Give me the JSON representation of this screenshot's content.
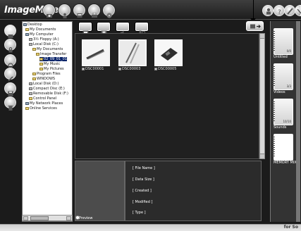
{
  "app": {
    "title": "ImageMixer"
  },
  "top_buttons": [
    {
      "icon": "camera-icon"
    },
    {
      "icon": "person-icon"
    },
    {
      "icon": "album-icon"
    },
    {
      "icon": "print-icon"
    },
    {
      "icon": "cd-icon"
    }
  ],
  "right_buttons": [
    {
      "icon": "person-icon"
    },
    {
      "icon": "help-icon"
    },
    {
      "icon": "pen-icon"
    },
    {
      "icon": "close-icon"
    }
  ],
  "left_tools": [
    {
      "icon": "folder-icon"
    },
    {
      "icon": "lock-icon"
    },
    {
      "icon": "rotate-icon"
    },
    {
      "icon": "wrench-icon"
    },
    {
      "icon": "disk-icon"
    },
    {
      "icon": "trash-icon"
    }
  ],
  "tree": [
    {
      "label": "Desktop",
      "type": "pc"
    },
    {
      "label": "My Documents",
      "type": "folder"
    },
    {
      "label": "My Computer",
      "type": "pc"
    },
    {
      "label": "3½ Floppy (A:)",
      "type": "drive"
    },
    {
      "label": "Local Disk (C:)",
      "type": "drive"
    },
    {
      "label": "My Documents",
      "type": "folder"
    },
    {
      "label": "Image Transfer",
      "type": "folder"
    },
    {
      "label": "02_09_01_01",
      "type": "folder",
      "selected": true
    },
    {
      "label": "My Music",
      "type": "folder"
    },
    {
      "label": "My Pictures",
      "type": "folder"
    },
    {
      "label": "Program Files",
      "type": "folder"
    },
    {
      "label": "WINDOWS",
      "type": "folder"
    },
    {
      "label": "Local Disk (D:)",
      "type": "drive"
    },
    {
      "label": "Compact Disc (E:)",
      "type": "drive"
    },
    {
      "label": "Removable Disk (F:)",
      "type": "drive"
    },
    {
      "label": "Control Panel",
      "type": "folder"
    },
    {
      "label": "My Network Places",
      "type": "pc"
    },
    {
      "label": "Online Services",
      "type": "folder"
    }
  ],
  "view_buttons": [
    {
      "icon": "image-icon"
    },
    {
      "icon": "film-icon"
    },
    {
      "icon": "sound-icon"
    },
    {
      "icon": "mixed-icon"
    }
  ],
  "action_button": {
    "icon": "transfer-icon"
  },
  "thumbnails": [
    {
      "caption": "DSC00001"
    },
    {
      "caption": "DSC00003"
    },
    {
      "caption": "DSC00005"
    }
  ],
  "preview": {
    "label": "Preview"
  },
  "info_fields": [
    "[ File Name ]",
    "[ Data Size ]",
    "[ Created ]",
    "[ Modified ]",
    "[ Type ]"
  ],
  "right_panel": [
    {
      "label": "Untitled",
      "count": "0/0"
    },
    {
      "label": "Videos",
      "count": "3/3"
    },
    {
      "label": "Sounds",
      "count": "10/10"
    },
    {
      "label": "MEMORY MIX",
      "count": ""
    }
  ],
  "bottom": {
    "text": "for So"
  }
}
